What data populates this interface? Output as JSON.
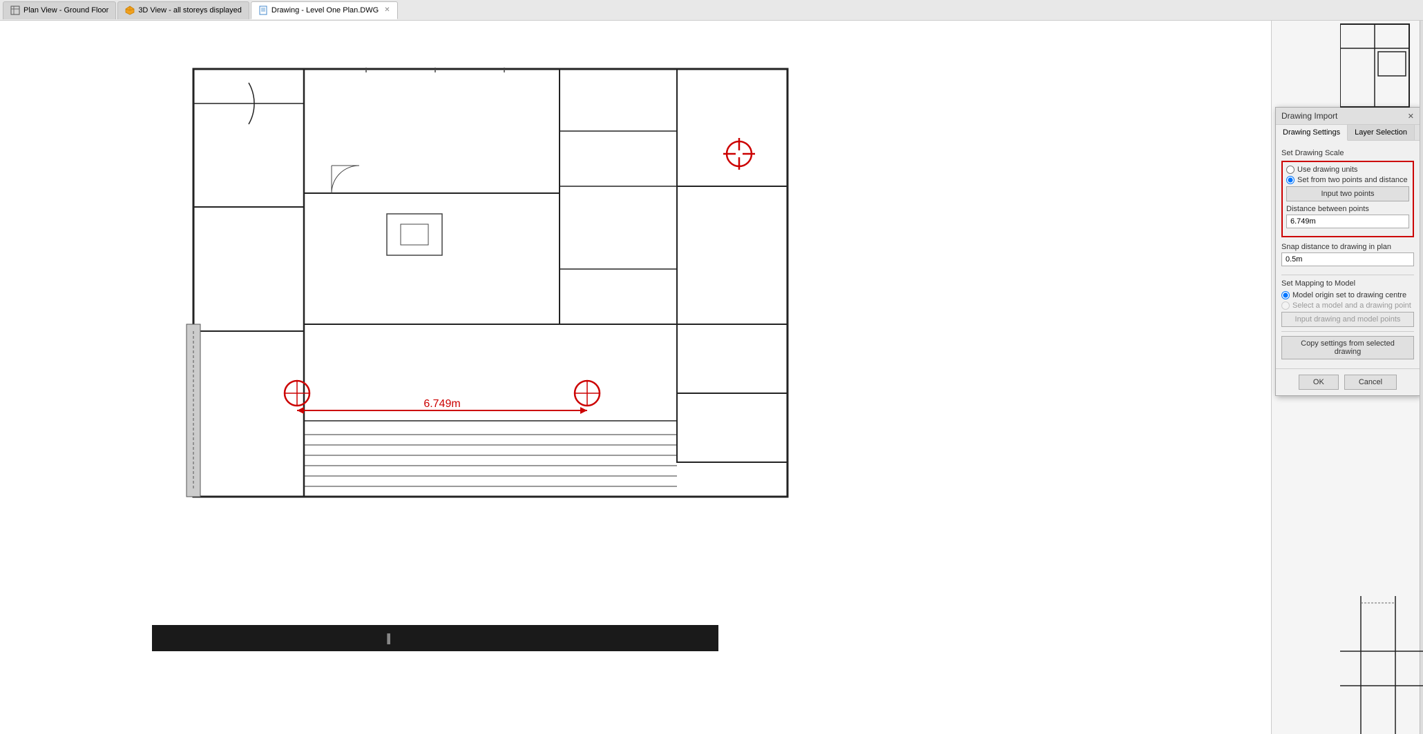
{
  "titlebar": {
    "tabs": [
      {
        "id": "plan-view",
        "label": "Plan View - Ground Floor",
        "icon": "plan-icon",
        "active": false,
        "closable": false
      },
      {
        "id": "3d-view",
        "label": "3D View - all storeys displayed",
        "icon": "3d-icon",
        "active": false,
        "closable": false
      },
      {
        "id": "drawing",
        "label": "Drawing - Level One Plan.DWG",
        "icon": "drawing-icon",
        "active": true,
        "closable": true
      }
    ]
  },
  "dialog": {
    "title": "Drawing Import",
    "tabs": [
      {
        "id": "drawing-settings",
        "label": "Drawing Settings",
        "active": true
      },
      {
        "id": "layer-selection",
        "label": "Layer Selection",
        "active": false
      }
    ],
    "set_drawing_scale_label": "Set Drawing Scale",
    "radio_use_drawing_units": "Use drawing units",
    "radio_set_from_two_points": "Set from two points and distance",
    "radio_use_drawing_units_selected": false,
    "radio_set_from_two_points_selected": true,
    "input_two_points_btn": "Input two points",
    "distance_label": "Distance between points",
    "distance_value": "6.749m",
    "snap_distance_label": "Snap distance to drawing in plan",
    "snap_distance_value": "0.5m",
    "set_mapping_label": "Set Mapping to Model",
    "radio_model_origin": "Model origin set to drawing centre",
    "radio_select_model_point": "Select a model and a drawing point",
    "radio_model_origin_selected": true,
    "radio_select_model_point_selected": false,
    "input_drawing_model_points_btn": "Input drawing and model points",
    "copy_settings_btn": "Copy settings from selected drawing",
    "ok_btn": "OK",
    "cancel_btn": "Cancel"
  },
  "measurement": {
    "label": "6.749m"
  },
  "colors": {
    "red_border": "#cc0000",
    "accent_red": "#cc0000",
    "yellow_line": "#ffff00",
    "crosshair_red": "#cc0000"
  }
}
